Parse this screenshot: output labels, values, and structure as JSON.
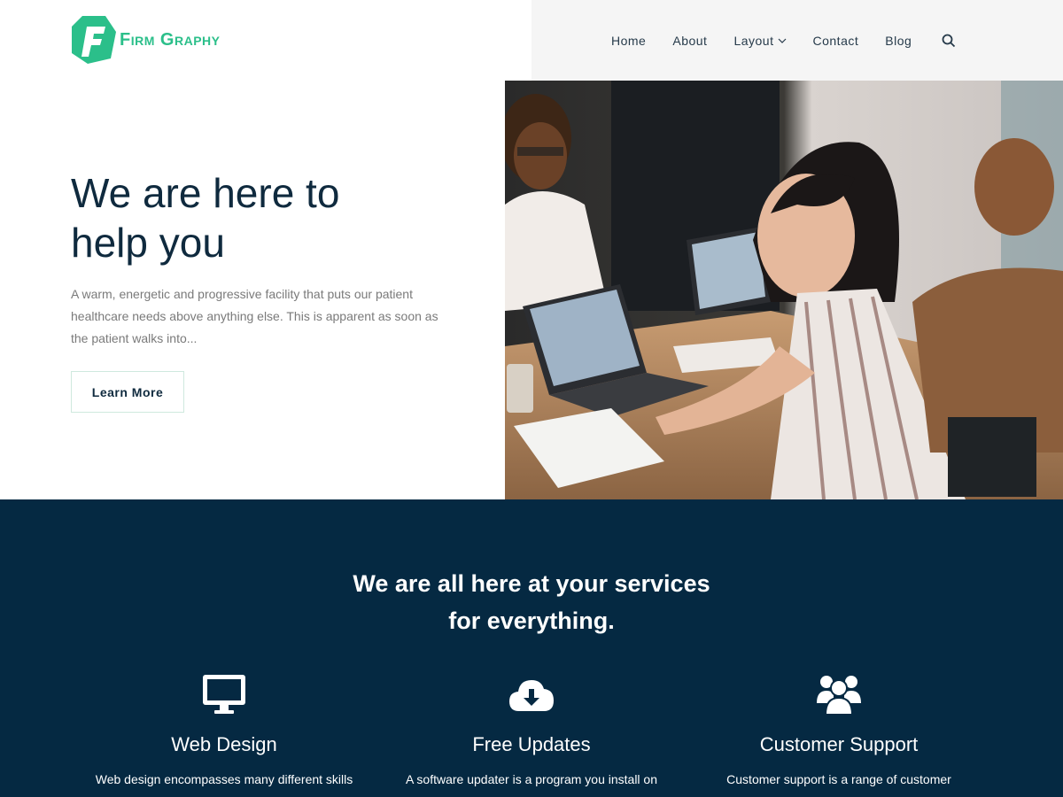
{
  "brand": {
    "name": "Firm Graphy",
    "color": "#2bbf8a"
  },
  "nav": {
    "items": [
      {
        "label": "Home"
      },
      {
        "label": "About"
      },
      {
        "label": "Layout"
      },
      {
        "label": "Contact"
      },
      {
        "label": "Blog"
      }
    ],
    "search_icon": "search-icon",
    "dropdown_icon": "chevron-down-icon"
  },
  "hero": {
    "title_line1": "We are here to",
    "title_line2": "help you",
    "description": "A warm, energetic and progressive facility that puts our patient healthcare needs above anything else. This is apparent as soon as the patient walks into...",
    "button_label": "Learn More"
  },
  "services": {
    "title_line1": "We are all here at your services",
    "title_line2": "for everything.",
    "items": [
      {
        "icon": "monitor-icon",
        "title": "Web Design",
        "text": "Web design encompasses many different skills"
      },
      {
        "icon": "cloud-download-icon",
        "title": "Free Updates",
        "text": "A software updater is a program you install on"
      },
      {
        "icon": "users-icon",
        "title": "Customer Support",
        "text": "Customer support is a range of customer"
      }
    ]
  },
  "colors": {
    "navy": "#052942",
    "heading": "#0f2a3e",
    "accent": "#2bbf8a"
  }
}
